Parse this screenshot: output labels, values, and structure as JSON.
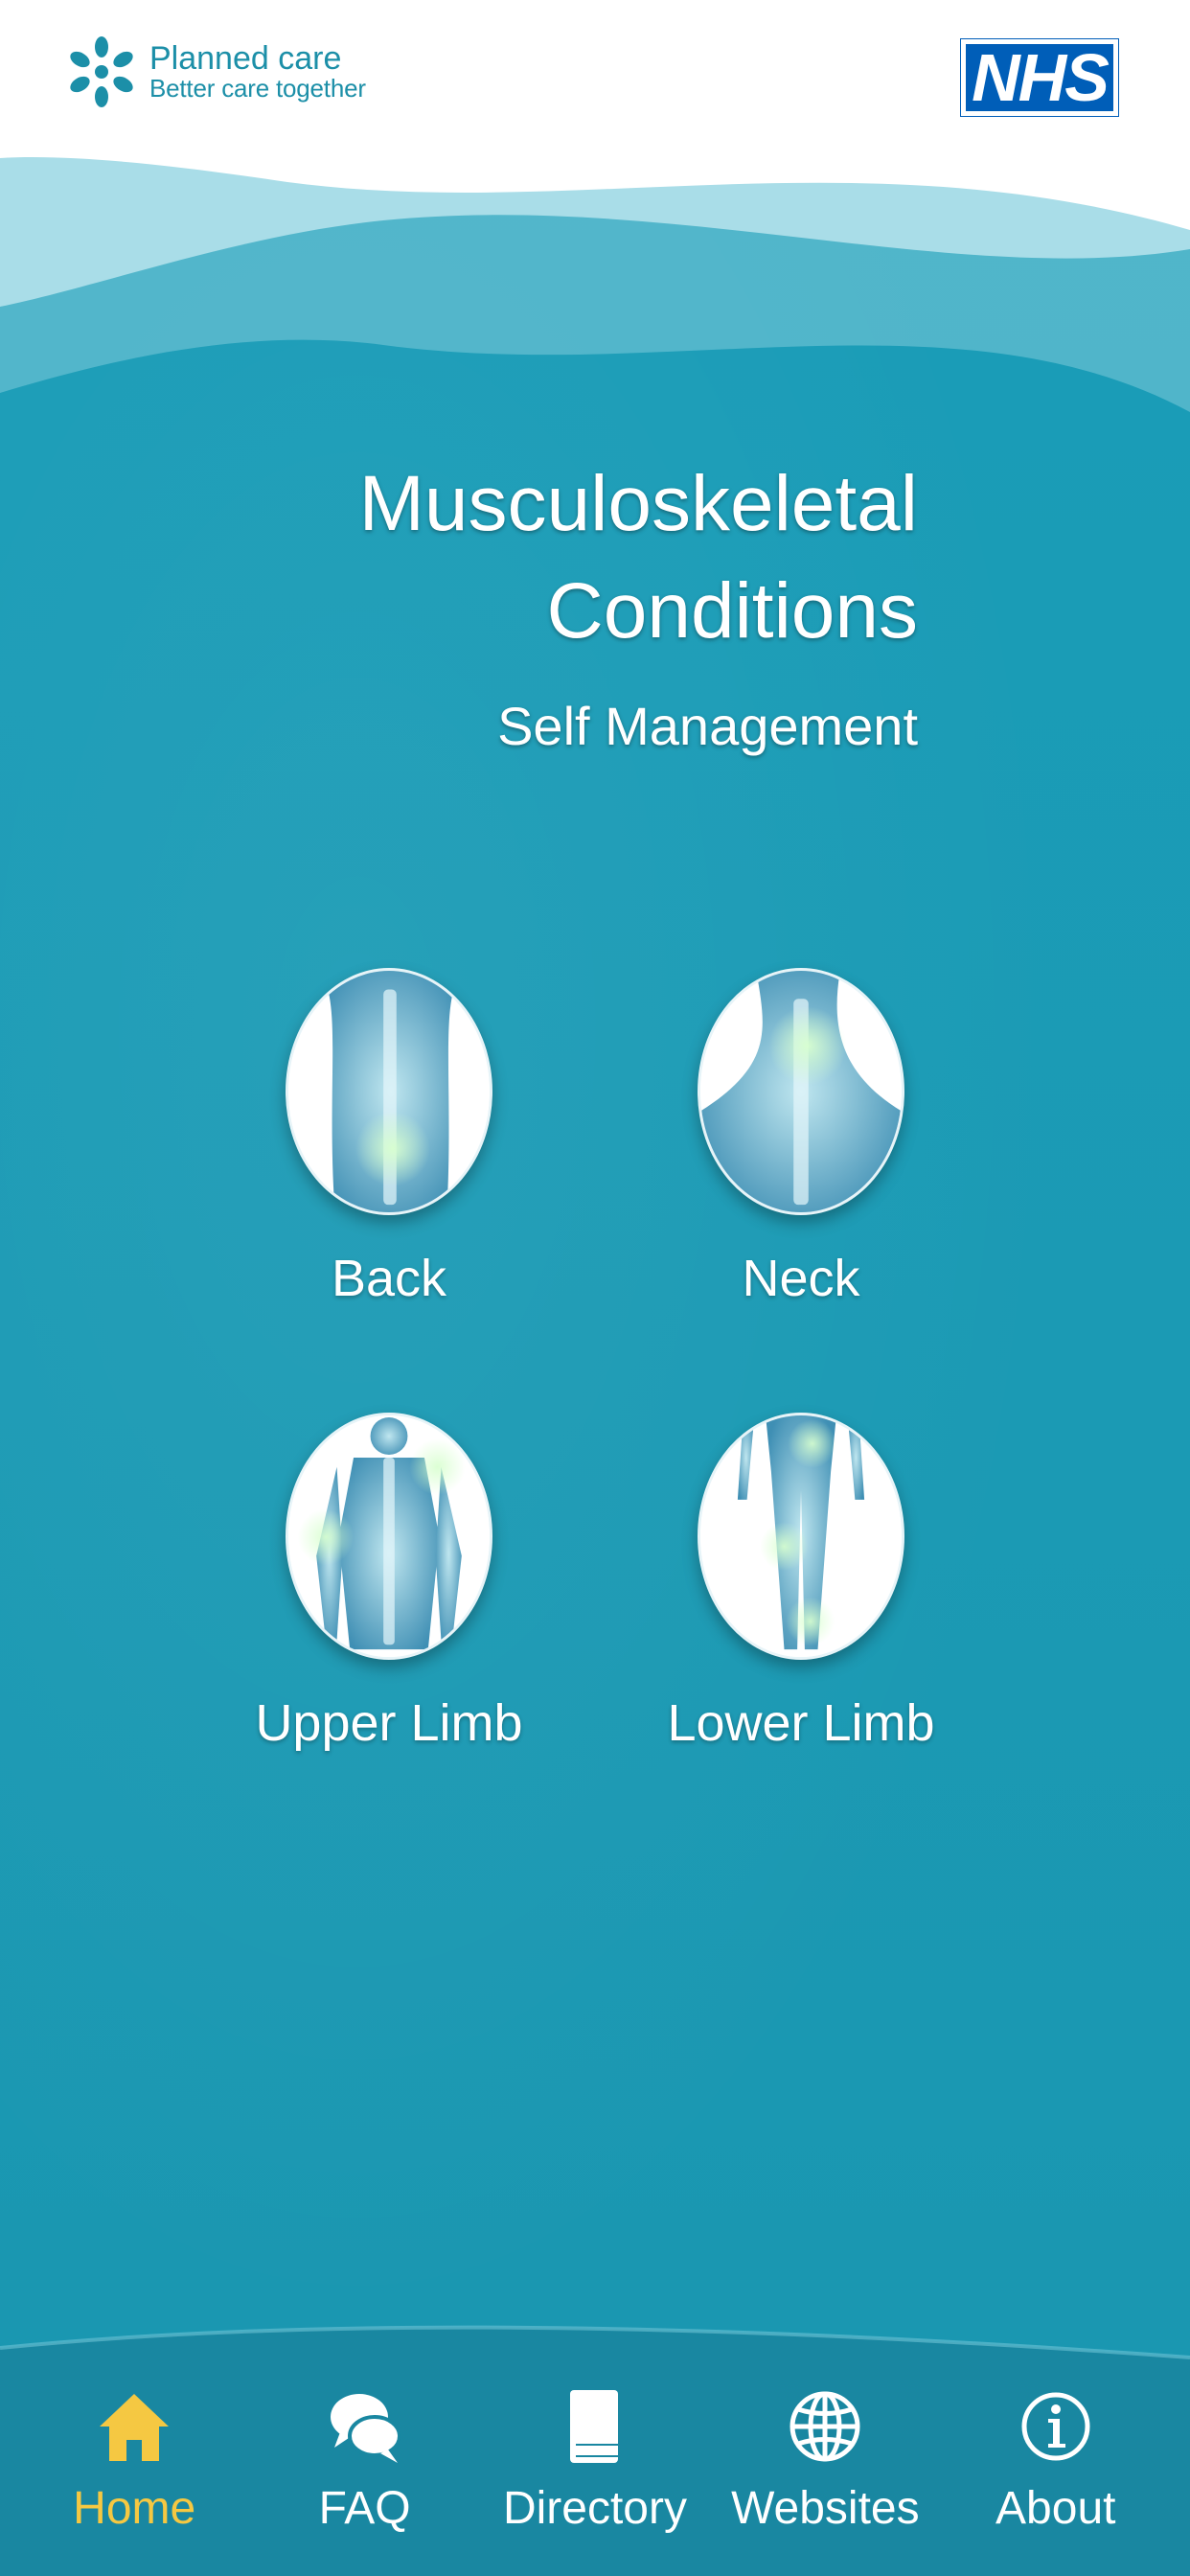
{
  "header": {
    "brand_title": "Planned care",
    "brand_subtitle": "Better care together",
    "nhs_logo": "NHS"
  },
  "title": {
    "line1": "Musculoskeletal",
    "line2": "Conditions",
    "subtitle": "Self Management"
  },
  "areas": [
    {
      "label": "Back",
      "icon": "back-xray-image"
    },
    {
      "label": "Neck",
      "icon": "neck-xray-image"
    },
    {
      "label": "Upper Limb",
      "icon": "upper-limb-xray-image"
    },
    {
      "label": "Lower Limb",
      "icon": "lower-limb-xray-image"
    }
  ],
  "nav": {
    "active": "Home",
    "items": [
      {
        "label": "Home",
        "icon": "home-icon"
      },
      {
        "label": "FAQ",
        "icon": "chat-bubbles-icon"
      },
      {
        "label": "Directory",
        "icon": "book-icon"
      },
      {
        "label": "Websites",
        "icon": "globe-icon"
      },
      {
        "label": "About",
        "icon": "info-icon"
      }
    ]
  },
  "colors": {
    "background": "#1b9cb6",
    "brand": "#1c8fa8",
    "nhs_blue": "#005eb8",
    "active_nav": "#f5c842",
    "text": "#ffffff"
  }
}
